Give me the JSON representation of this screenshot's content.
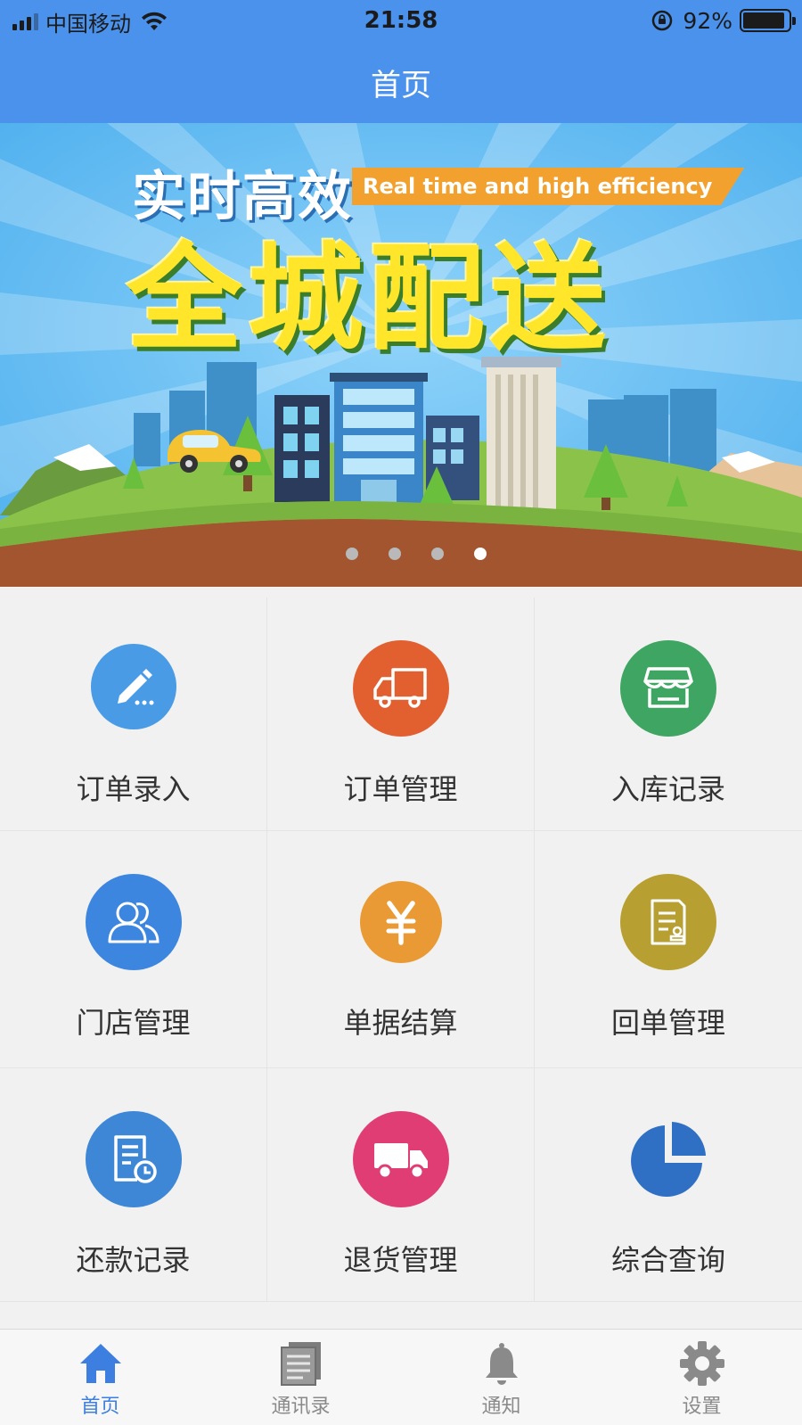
{
  "status_bar": {
    "carrier": "中国移动",
    "time": "21:58",
    "battery": "92%",
    "battery_level": 0.92
  },
  "header": {
    "title": "首页"
  },
  "banner": {
    "headline": "实时高效",
    "tagline": "Real time and high efficiency",
    "slogan": "全城配送",
    "slide_count": 4,
    "active_slide": 4
  },
  "grid": {
    "items": [
      {
        "label": "订单录入",
        "icon": "pencil-icon",
        "color": "#4a9be6"
      },
      {
        "label": "订单管理",
        "icon": "truck-outline-icon",
        "color": "#e2602f"
      },
      {
        "label": "入库记录",
        "icon": "store-icon",
        "color": "#3fa563"
      },
      {
        "label": "门店管理",
        "icon": "users-icon",
        "color": "#3d86e0"
      },
      {
        "label": "单据结算",
        "icon": "yen-icon",
        "color": "#e99a34"
      },
      {
        "label": "回单管理",
        "icon": "receipt-icon",
        "color": "#b7a031"
      },
      {
        "label": "还款记录",
        "icon": "document-clock-icon",
        "color": "#3d87d6"
      },
      {
        "label": "退货管理",
        "icon": "delivery-truck-icon",
        "color": "#e03d74"
      },
      {
        "label": "综合查询",
        "icon": "pie-chart-icon",
        "color": "#2f6fc4"
      }
    ]
  },
  "tabbar": {
    "items": [
      {
        "label": "首页",
        "icon": "home-icon",
        "active": true
      },
      {
        "label": "通讯录",
        "icon": "contacts-icon",
        "active": false
      },
      {
        "label": "通知",
        "icon": "bell-icon",
        "active": false
      },
      {
        "label": "设置",
        "icon": "gear-icon",
        "active": false
      }
    ],
    "active_color": "#3d7fe0"
  }
}
